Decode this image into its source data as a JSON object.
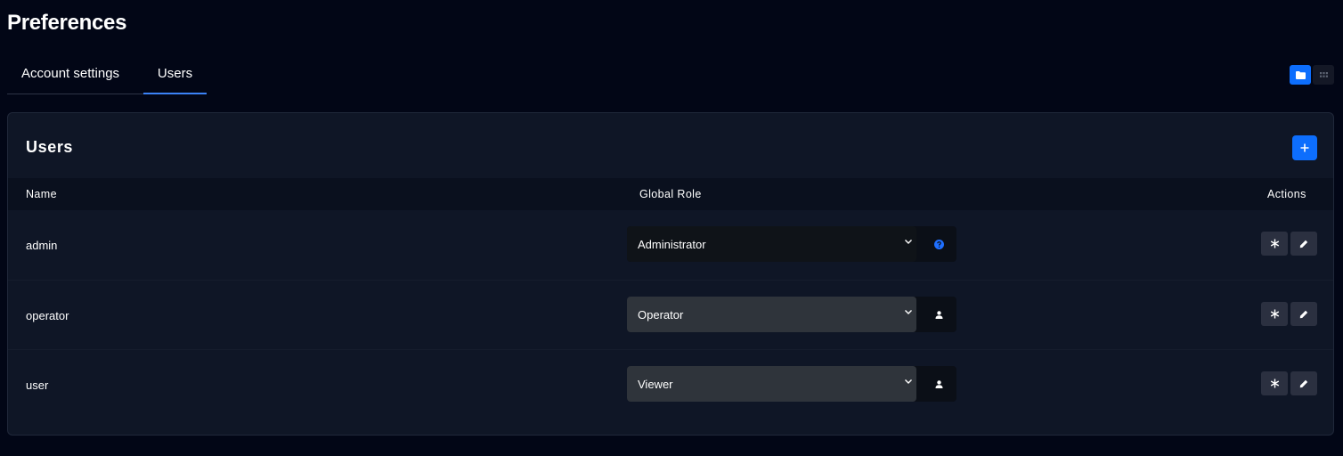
{
  "page": {
    "title": "Preferences"
  },
  "tabs": [
    {
      "label": "Account settings",
      "active": false
    },
    {
      "label": "Users",
      "active": true
    }
  ],
  "view_toggle": {
    "options": [
      "folder-icon",
      "grid-icon"
    ],
    "active": "folder-icon"
  },
  "users_card": {
    "title": "Users",
    "add_icon": "plus-icon",
    "columns": {
      "name": "Name",
      "role": "Global Role",
      "actions": "Actions"
    },
    "rows": [
      {
        "name": "admin",
        "role": "Administrator",
        "role_addon_icon": "help-icon"
      },
      {
        "name": "operator",
        "role": "Operator",
        "role_addon_icon": "user-icon"
      },
      {
        "name": "user",
        "role": "Viewer",
        "role_addon_icon": "user-icon"
      }
    ],
    "row_action_icons": [
      "asterisk-icon",
      "pencil-icon"
    ]
  },
  "colors": {
    "background": "#020616",
    "card": "#0f1626",
    "accent": "#0d6efd",
    "tab_underline": "#3b82f6"
  }
}
